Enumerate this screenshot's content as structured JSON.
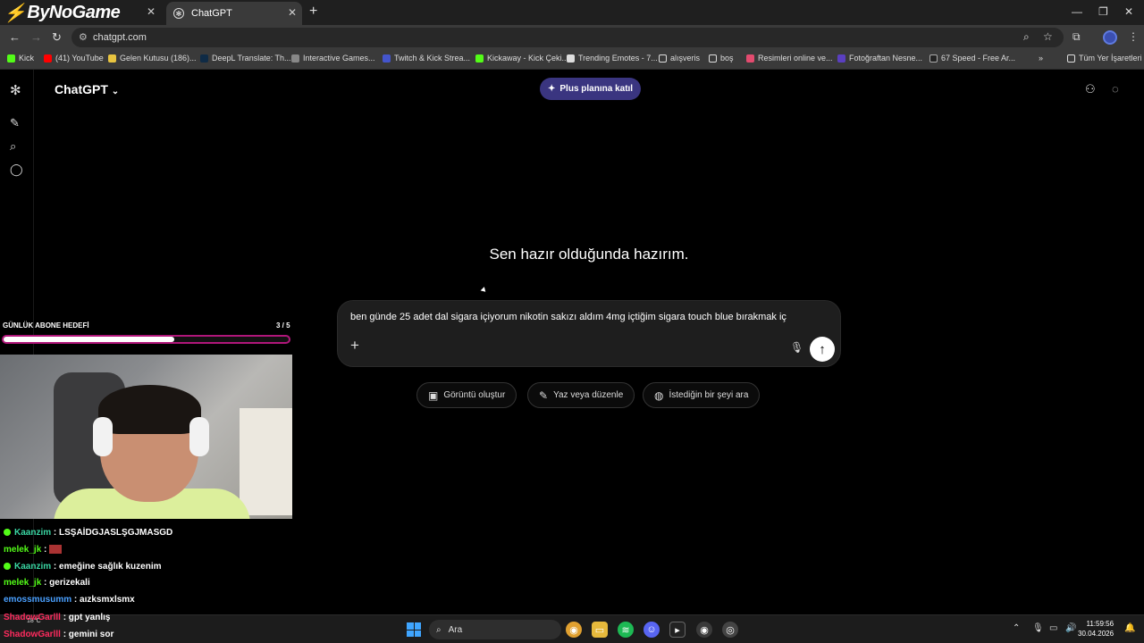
{
  "browser": {
    "brand_logo": "ByNoGame",
    "tab_title": "ChatGPT",
    "url": "chatgpt.com",
    "bookmarks": [
      "Kick",
      "(41) YouTube",
      "Gelen Kutusu (186)...",
      "DeepL Translate: Th...",
      "Interactive Games...",
      "Twitch & Kick Strea...",
      "Kickaway - Kick Çeki...",
      "Trending Emotes - 7...",
      "alışveris",
      "boş",
      "Resimleri online ve...",
      "Fotoğraftan Nesne...",
      "67 Speed - Free Ar..."
    ],
    "all_bookmarks": "Tüm Yer İşaretleri"
  },
  "chatgpt": {
    "model": "ChatGPT",
    "upgrade_label": "Plus planına katıl",
    "hero": "Sen hazır olduğunda hazırım.",
    "prompt_text": "ben günde 25 adet dal sigara içiyorum nikotin sakızı aldım 4mg içtiğim sigara touch blue bırakmak iç",
    "actions": [
      "Görüntü oluştur",
      "Yaz veya düzenle",
      "İstediğin bir şeyi ara"
    ]
  },
  "overlay": {
    "goal_label": "GÜNLÜK ABONE HEDEFİ",
    "goal_count": "3 / 5",
    "goal_progress": 0.6,
    "chat": [
      {
        "user": "Kaanzim",
        "message": ": LSŞAİDGJASLŞGJMASGD"
      },
      {
        "user": "melek_jk",
        "message": ":"
      },
      {
        "user": "Kaanzim",
        "message": ": emeğine sağlık kuzenim"
      },
      {
        "user": "melek_jk",
        "message": ": gerizekali"
      },
      {
        "user": "emossmusumm",
        "message": ": aızksmxlsmx"
      },
      {
        "user": "ShadowGarlll",
        "message": ": gpt yanlış"
      },
      {
        "user": "ShadowGarlll",
        "message": ": gemini sor"
      }
    ]
  },
  "taskbar": {
    "search_label": "Ara",
    "weather": "18°C",
    "time": "11:59:56",
    "date": "30.04.2026"
  }
}
